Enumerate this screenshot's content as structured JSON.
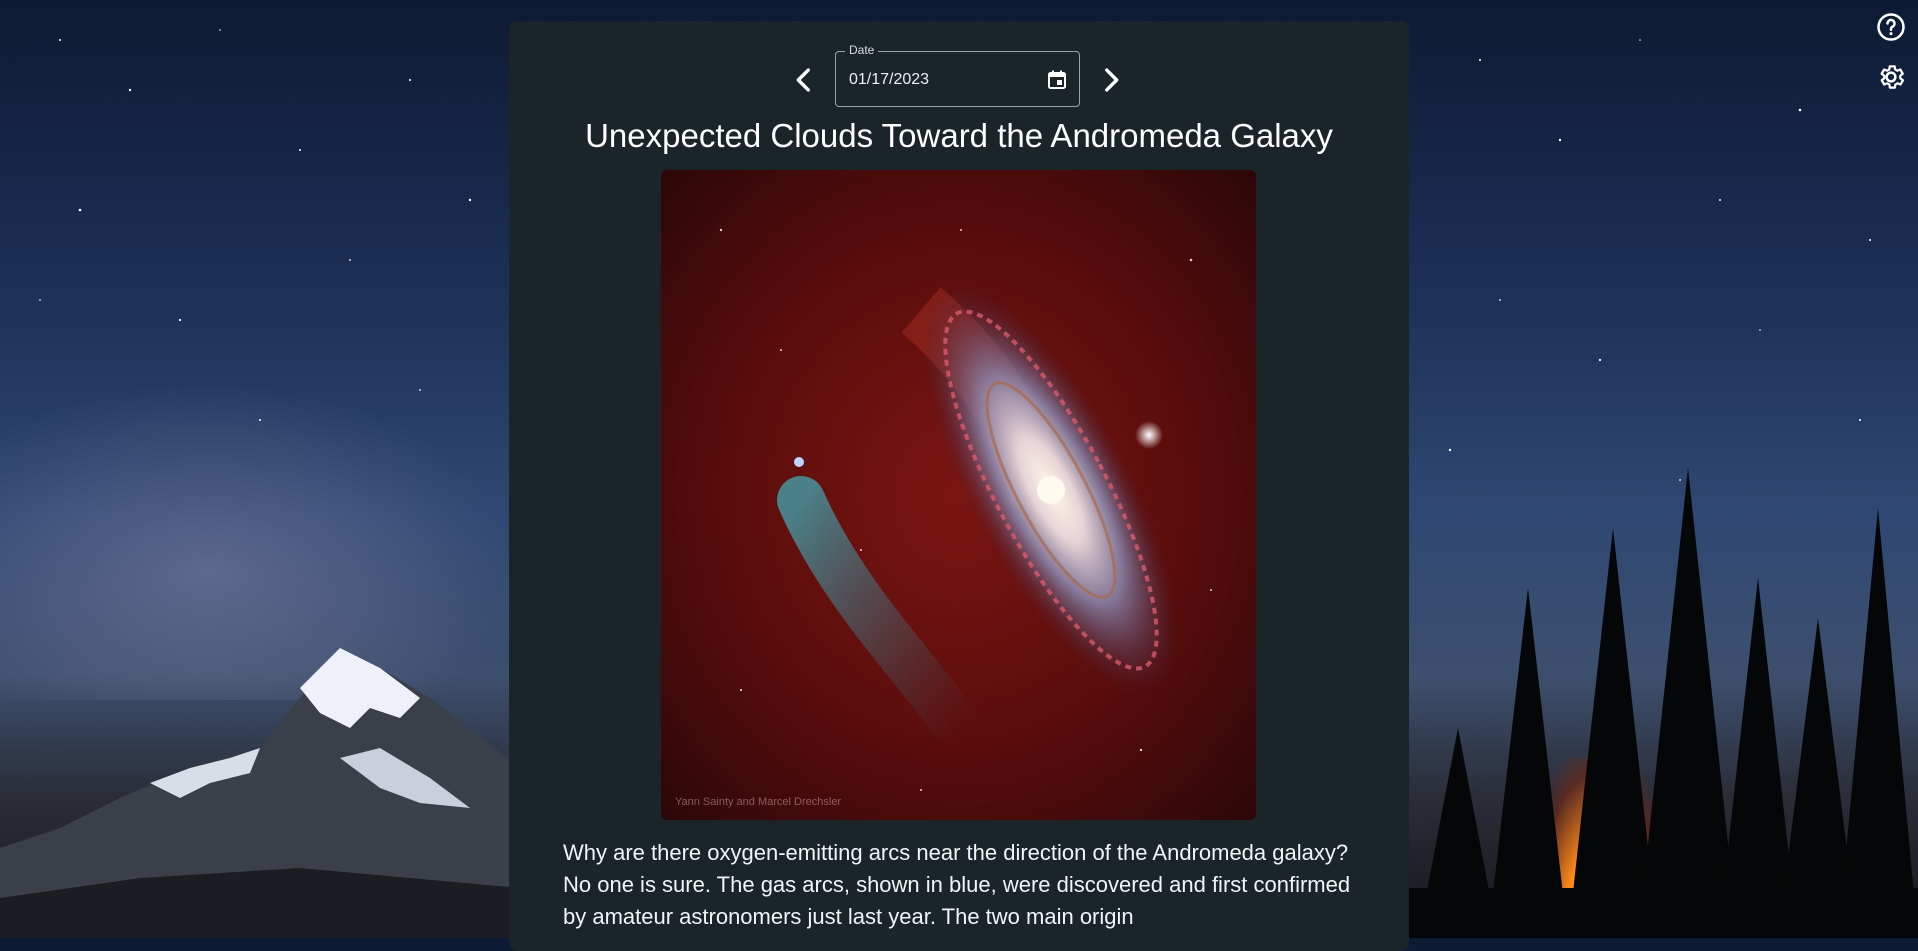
{
  "header_icons": {
    "help": "help-circle-icon",
    "settings": "gear-icon"
  },
  "date_picker": {
    "label": "Date",
    "value": "01/17/2023",
    "prev_icon": "chevron-left-icon",
    "next_icon": "chevron-right-icon",
    "calendar_icon": "calendar-icon"
  },
  "apod": {
    "title": "Unexpected Clouds Toward the Andromeda Galaxy",
    "image_credit": "Yann Sainty and Marcel Drechsler",
    "explanation": "Why are there oxygen-emitting arcs near the direction of the Andromeda galaxy? No one is sure. The gas arcs, shown in blue, were discovered and first confirmed by amateur astronomers just last year. The two main origin"
  },
  "colors": {
    "card_bg": "#1b2429",
    "text": "#ffffff",
    "field_border": "#9aa3a8"
  }
}
